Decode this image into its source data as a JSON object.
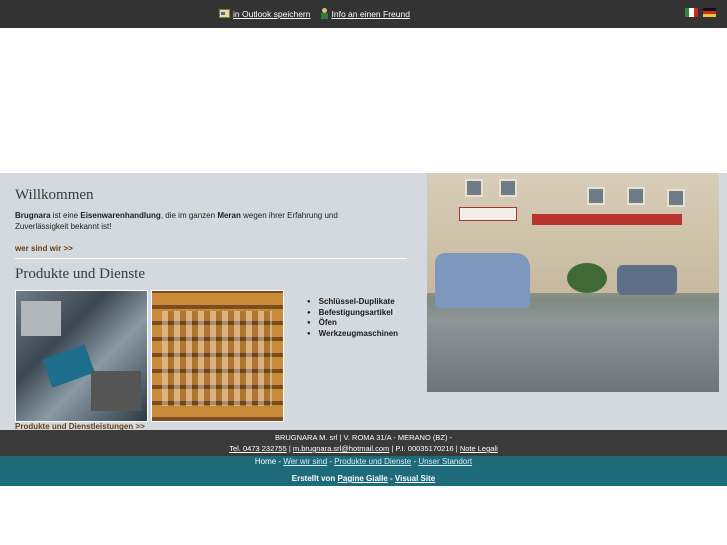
{
  "topbar": {
    "outlook_label": "in Outlook speichern",
    "friend_label": "Info an einen Freund",
    "flags": [
      {
        "name": "italian-flag",
        "colors": [
          "#2e8b3a",
          "#ffffff",
          "#cc2a2a"
        ]
      },
      {
        "name": "german-flag",
        "colors": [
          "#111111",
          "#cc2a2a",
          "#f2c12e"
        ]
      }
    ]
  },
  "welcome": {
    "title": "Willkommen",
    "brand": "Brugnara",
    "text_1": " ist eine ",
    "shop_type": "Eisenwarenhandlung",
    "text_2": ", die im ganzen ",
    "city": "Meran",
    "text_3": " wegen ihrer Erfahrung und Zuverlässigkeit bekannt ist!",
    "more_link": "wer sind wir >>"
  },
  "products": {
    "title": "Produkte und Dienste",
    "items": [
      "Schlüssel-Duplikate",
      "Befestigungsartikel",
      "Öfen",
      "Werkzeugmaschinen"
    ],
    "more_link": "Produkte und Dienstleistungen >>"
  },
  "footer": {
    "address": "BRUGNARA M. srl | V. ROMA 31/A - MERANO (BZ) -",
    "phone": "Tel. 0473 232755",
    "sep1": " | ",
    "email": "m.brugnara.srl@hotmail.com",
    "vat": " | P.I. 00035170216 | ",
    "legal": "Note Legali",
    "nav": {
      "home": "Home",
      "sep": " - ",
      "about": "Wer wir sind",
      "products": "Produkte und Dienste",
      "location": "Unser Standort"
    },
    "credits": {
      "prefix": "Erstellt von ",
      "pg": "Pagine Gialle",
      "dash": " - ",
      "vs": "Visual Site"
    }
  }
}
